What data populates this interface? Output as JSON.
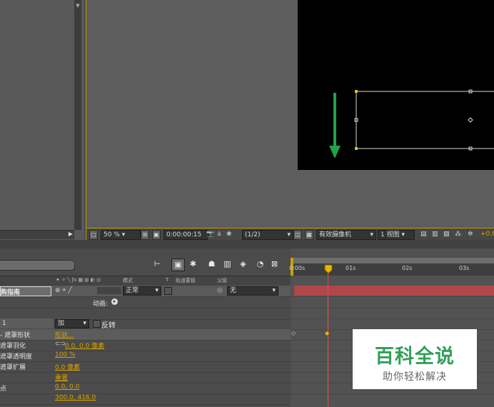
{
  "comp_toolbar": {
    "zoom": "50 %",
    "timecode": "0:00:00:15",
    "resolution": "(1/2)",
    "camera": "有效摄像机",
    "view": "1 视图",
    "exposure": "+0.0"
  },
  "timeline_header": {
    "columns": [
      "模式",
      "T",
      "轨道蒙板",
      "父级"
    ]
  },
  "ruler": {
    "ticks": [
      "0:00s",
      "01s",
      "02s",
      "03s"
    ]
  },
  "layer": {
    "name": "购指南",
    "mode": "正常",
    "parent": "无",
    "anim_label": "动画:"
  },
  "mask": {
    "index": "1",
    "mode": "加",
    "invert_label": "反转",
    "props": [
      {
        "label": "遮罩形状",
        "value": "形状..."
      },
      {
        "label": "遮罩羽化",
        "value": "0.0, 0.0 像素"
      },
      {
        "label": "遮罩透明度",
        "value": "100 %"
      },
      {
        "label": "遮罩扩展",
        "value": "0.0 像素"
      }
    ]
  },
  "transform": {
    "reset": "重置",
    "anchor_label": "点",
    "anchor_value": "0.0, 0.0",
    "position_value": "300.0, 416.0"
  },
  "watermark": {
    "title": "百科全说",
    "subtitle": "助你轻松解决"
  },
  "colors": {
    "arrow": "#1fa24a",
    "layer_bar": "#b0474b",
    "timeline_accent": "#c9a100",
    "mask_path": "#d9d9d9"
  }
}
